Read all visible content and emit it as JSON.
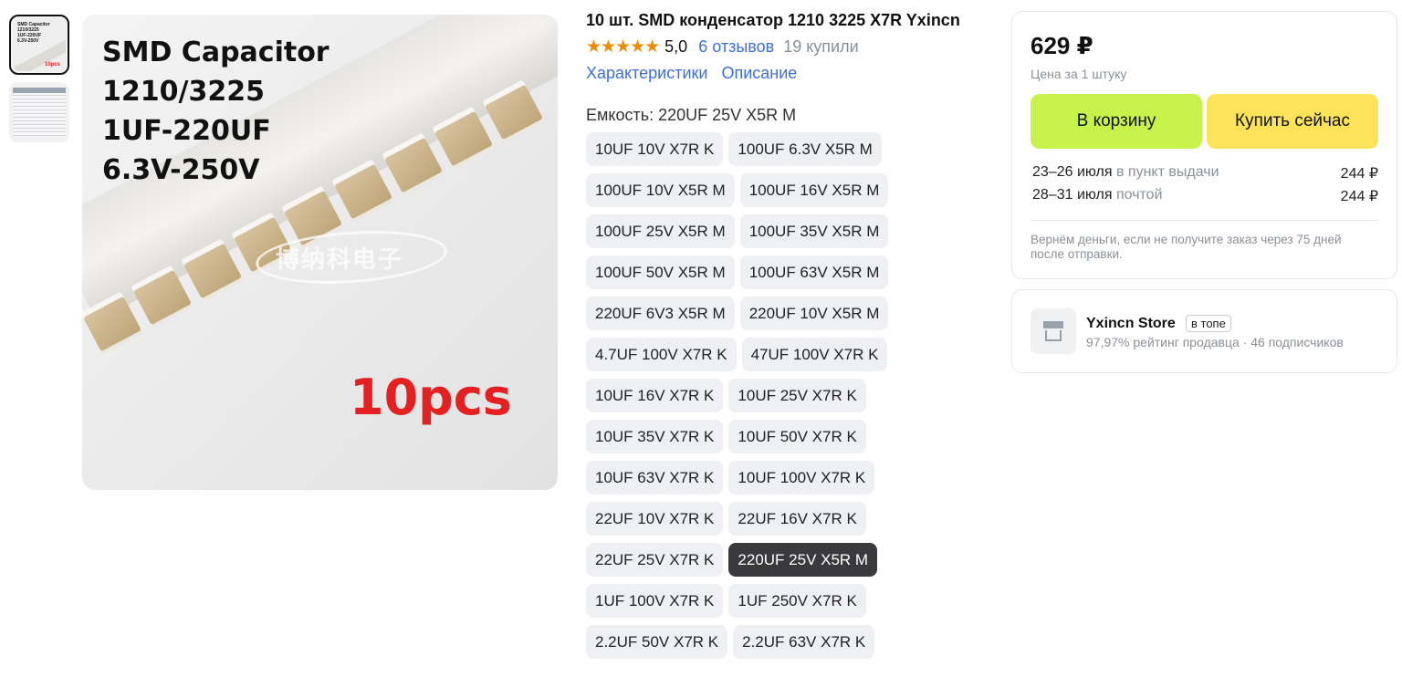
{
  "gallery": {
    "main_image": {
      "title_lines": [
        "SMD Capacitor",
        "1210/3225",
        "1UF-220UF",
        "6.3V-250V"
      ],
      "count_label": "10pcs",
      "watermark": "博纳科电子"
    },
    "thumbnails": [
      "capacitor-photo",
      "spec-table"
    ]
  },
  "product": {
    "title": "10 шт. SMD конденсатор 1210 3225 X7R Yxincn",
    "rating_value": "5,0",
    "stars": "★★★★★",
    "reviews": "6 отзывов",
    "bought": "19 купили",
    "link_specs": "Характеристики",
    "link_description": "Описание"
  },
  "capacitance": {
    "label": "Емкость: 220UF 25V X5R M",
    "selected_index": 23,
    "options": [
      "10UF 10V X7R K",
      "100UF 6.3V X5R M",
      "100UF 10V X5R M",
      "100UF 16V X5R M",
      "100UF 25V X5R M",
      "100UF 35V X5R M",
      "100UF 50V X5R M",
      "100UF 63V X5R M",
      "220UF 6V3 X5R M",
      "220UF 10V X5R M",
      "4.7UF 100V X7R K",
      "47UF 100V X7R K",
      "10UF 16V X7R K",
      "10UF 25V X7R K",
      "10UF 35V X7R K",
      "10UF 50V X7R K",
      "10UF 63V X7R K",
      "10UF 100V X7R K",
      "22UF 10V X7R K",
      "22UF 16V X7R K",
      "22UF 25V X7R K",
      "220UF 25V X5R M",
      "1UF 100V X7R K",
      "1UF 250V X7R K",
      "2.2UF 50V X7R K",
      "2.2UF 63V X7R K"
    ]
  },
  "purchase": {
    "price": "629 ₽",
    "price_note": "Цена за 1 штуку",
    "cart_button": "В корзину",
    "buy_button": "Купить сейчас",
    "delivery": [
      {
        "dates": "23–26 июля",
        "method": "в пункт выдачи",
        "price": "244 ₽"
      },
      {
        "dates": "28–31 июля",
        "method": "почтой",
        "price": "244 ₽"
      }
    ],
    "refund_note": "Вернём деньги, если не получите заказ через 75 дней после отправки."
  },
  "store": {
    "name": "Yxincn Store",
    "badge": "в топе",
    "rating": "97,97% рейтинг продавца",
    "separator": "·",
    "subscribers": "46 подписчиков"
  },
  "colors": {
    "accent_link": "#3b6fe0",
    "star": "#f28a00",
    "cart_button": "#c6f24a",
    "buy_button": "#fde35a",
    "selected_option": "#3a3a3c",
    "image_red_text": "#e42020"
  }
}
